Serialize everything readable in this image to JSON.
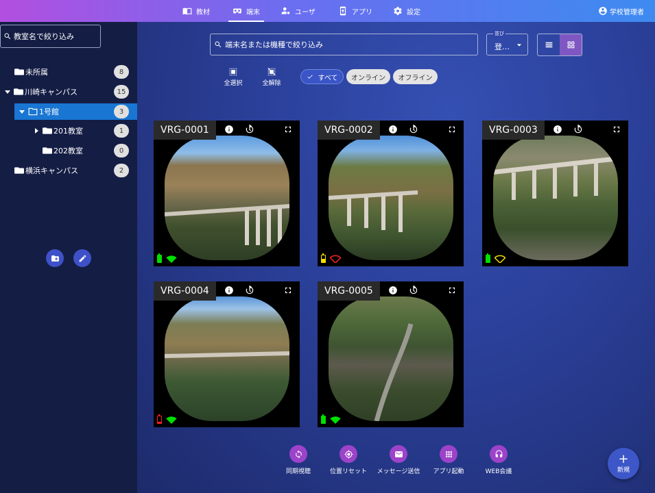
{
  "topnav": [
    {
      "label": "教材",
      "icon": "book-icon"
    },
    {
      "label": "端末",
      "icon": "vr-headset-icon",
      "active": true
    },
    {
      "label": "ユーザ",
      "icon": "users-cog-icon"
    },
    {
      "label": "アプリ",
      "icon": "app-device-icon"
    },
    {
      "label": "設定",
      "icon": "gear-icon"
    }
  ],
  "user": {
    "label": "学校管理者",
    "icon": "account-circle-icon"
  },
  "sidebar": {
    "search_placeholder": "教室名で絞り込み",
    "tree": [
      {
        "label": "未所属",
        "count": "8"
      },
      {
        "label": "川崎キャンパス",
        "count": "15"
      },
      {
        "label": "1号館",
        "count": "3"
      },
      {
        "label": "201教室",
        "count": "1"
      },
      {
        "label": "202教室",
        "count": "0"
      },
      {
        "label": "横浜キャンパス",
        "count": "2"
      }
    ],
    "add_folder_icon": "create-new-folder-icon",
    "edit_icon": "pencil-icon"
  },
  "toolbar": {
    "search_placeholder": "端末名または機種で絞り込み",
    "sort_label": "並び",
    "sort_value": "登…",
    "select_all": "全選択",
    "deselect_all": "全解除"
  },
  "filters": {
    "all": "すべて",
    "online": "オンライン",
    "offline": "オフライン"
  },
  "devices": [
    {
      "name": "VRG-0001",
      "battery_color": "#00e000",
      "battery_level": 1.0,
      "wifi_color": "#00e000"
    },
    {
      "name": "VRG-0002",
      "battery_color": "#f4e000",
      "battery_level": 0.5,
      "wifi_color": "#ff2020"
    },
    {
      "name": "VRG-0003",
      "battery_color": "#00e000",
      "battery_level": 1.0,
      "wifi_color": "#f4e000"
    },
    {
      "name": "VRG-0004",
      "battery_color": "#ff2020",
      "battery_level": 0.2,
      "wifi_color": "#00e000"
    },
    {
      "name": "VRG-0005",
      "battery_color": "#00e000",
      "battery_level": 1.0,
      "wifi_color": "#00e000"
    }
  ],
  "actions": [
    {
      "label": "同期視聴",
      "icon": "sync-icon"
    },
    {
      "label": "位置リセット",
      "icon": "crosshair-icon"
    },
    {
      "label": "メッセージ送信",
      "icon": "mail-icon"
    },
    {
      "label": "アプリ起動",
      "icon": "apps-grid-icon"
    },
    {
      "label": "WEB会議",
      "icon": "headset-icon"
    }
  ],
  "fab": {
    "label": "新規",
    "symbol": "+"
  }
}
